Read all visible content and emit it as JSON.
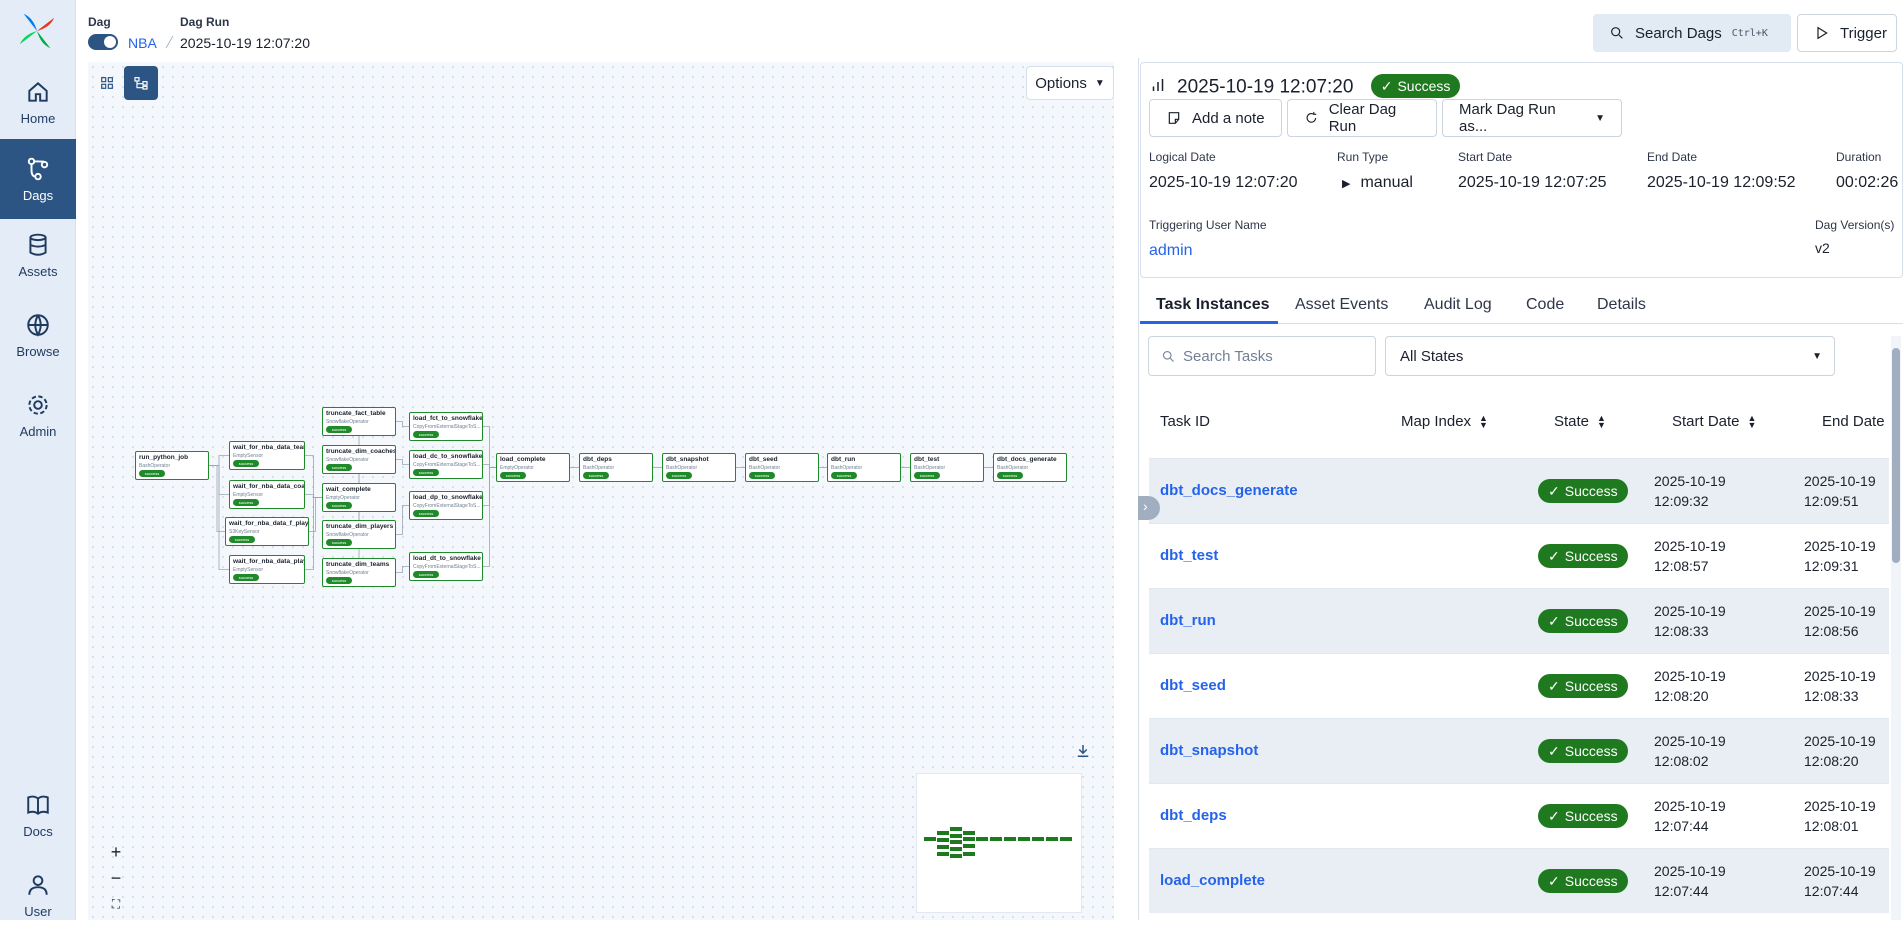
{
  "sidebar": {
    "items": [
      {
        "label": "Home",
        "icon": "home-icon"
      },
      {
        "label": "Dags",
        "icon": "dags-icon"
      },
      {
        "label": "Assets",
        "icon": "assets-icon"
      },
      {
        "label": "Browse",
        "icon": "globe-icon"
      },
      {
        "label": "Admin",
        "icon": "gear-icon"
      },
      {
        "label": "Docs",
        "icon": "book-icon"
      },
      {
        "label": "User",
        "icon": "user-icon"
      }
    ]
  },
  "header": {
    "dag_label": "Dag",
    "dag_name": "NBA",
    "run_label": "Dag Run",
    "run_date": "2025-10-19 12:07:20",
    "search_label": "Search Dags",
    "search_shortcut": "Ctrl+K",
    "trigger_label": "Trigger"
  },
  "graph": {
    "options_label": "Options",
    "nodes": [
      {
        "name": "run_python_job",
        "op": "BashOperator",
        "state": "success"
      },
      {
        "name": "wait_for_nba_data_team",
        "op": "EmptySensor",
        "state": "success"
      },
      {
        "name": "wait_for_nba_data_coach",
        "op": "EmptySensor",
        "state": "success"
      },
      {
        "name": "wait_for_nba_data_f_player",
        "op": "S3KeySensor",
        "state": "success"
      },
      {
        "name": "wait_for_nba_data_player",
        "op": "EmptySensor",
        "state": "success"
      },
      {
        "name": "truncate_fact_table",
        "op": "SnowflakeOperator",
        "state": "success"
      },
      {
        "name": "truncate_dim_coaches",
        "op": "SnowflakeOperator",
        "state": "success"
      },
      {
        "name": "wait_complete",
        "op": "EmptyOperator",
        "state": "success"
      },
      {
        "name": "truncate_dim_players",
        "op": "SnowflakeOperator",
        "state": "success"
      },
      {
        "name": "truncate_dim_teams",
        "op": "SnowflakeOperator",
        "state": "success"
      },
      {
        "name": "load_fct_to_snowflake",
        "op": "CopyFromExternalStageToS...",
        "state": "success"
      },
      {
        "name": "load_dc_to_snowflake",
        "op": "CopyFromExternalStageToS...",
        "state": "success"
      },
      {
        "name": "load_dp_to_snowflake",
        "op": "CopyFromExternalStageToS...",
        "state": "success"
      },
      {
        "name": "load_dt_to_snowflake",
        "op": "CopyFromExternalStageToS...",
        "state": "success"
      },
      {
        "name": "load_complete",
        "op": "EmptyOperator",
        "state": "success"
      },
      {
        "name": "dbt_deps",
        "op": "BashOperator",
        "state": "success"
      },
      {
        "name": "dbt_snapshot",
        "op": "BashOperator",
        "state": "success"
      },
      {
        "name": "dbt_seed",
        "op": "BashOperator",
        "state": "success"
      },
      {
        "name": "dbt_run",
        "op": "BashOperator",
        "state": "success"
      },
      {
        "name": "dbt_test",
        "op": "BashOperator",
        "state": "success"
      },
      {
        "name": "dbt_docs_generate",
        "op": "BashOperator",
        "state": "success"
      }
    ]
  },
  "run": {
    "title": "2025-10-19 12:07:20",
    "state": "Success",
    "actions": {
      "note": "Add a note",
      "clear": "Clear Dag Run",
      "mark": "Mark Dag Run as..."
    },
    "fields": {
      "logical_date_label": "Logical Date",
      "logical_date": "2025-10-19 12:07:20",
      "run_type_label": "Run Type",
      "run_type": "manual",
      "start_date_label": "Start Date",
      "start_date": "2025-10-19 12:07:25",
      "end_date_label": "End Date",
      "end_date": "2025-10-19 12:09:52",
      "duration_label": "Duration",
      "duration": "00:02:26",
      "trigger_user_label": "Triggering User Name",
      "trigger_user": "admin",
      "version_label": "Dag Version(s)",
      "version": "v2"
    }
  },
  "tabs": [
    "Task Instances",
    "Asset Events",
    "Audit Log",
    "Code",
    "Details"
  ],
  "tasks": {
    "search_placeholder": "Search Tasks",
    "state_filter": "All States",
    "columns": [
      "Task ID",
      "Map Index",
      "State",
      "Start Date",
      "End Date"
    ],
    "rows": [
      {
        "id": "dbt_docs_generate",
        "state": "Success",
        "start": [
          "2025-10-19",
          "12:09:32"
        ],
        "end": [
          "2025-10-19",
          "12:09:51"
        ]
      },
      {
        "id": "dbt_test",
        "state": "Success",
        "start": [
          "2025-10-19",
          "12:08:57"
        ],
        "end": [
          "2025-10-19",
          "12:09:31"
        ]
      },
      {
        "id": "dbt_run",
        "state": "Success",
        "start": [
          "2025-10-19",
          "12:08:33"
        ],
        "end": [
          "2025-10-19",
          "12:08:56"
        ]
      },
      {
        "id": "dbt_seed",
        "state": "Success",
        "start": [
          "2025-10-19",
          "12:08:20"
        ],
        "end": [
          "2025-10-19",
          "12:08:33"
        ]
      },
      {
        "id": "dbt_snapshot",
        "state": "Success",
        "start": [
          "2025-10-19",
          "12:08:02"
        ],
        "end": [
          "2025-10-19",
          "12:08:20"
        ]
      },
      {
        "id": "dbt_deps",
        "state": "Success",
        "start": [
          "2025-10-19",
          "12:07:44"
        ],
        "end": [
          "2025-10-19",
          "12:08:01"
        ]
      },
      {
        "id": "load_complete",
        "state": "Success",
        "start": [
          "2025-10-19",
          "12:07:44"
        ],
        "end": [
          "2025-10-19",
          "12:07:44"
        ]
      }
    ]
  },
  "colors": {
    "accent": "#2d5584",
    "success": "#1f7a1f",
    "link": "#2563eb"
  }
}
